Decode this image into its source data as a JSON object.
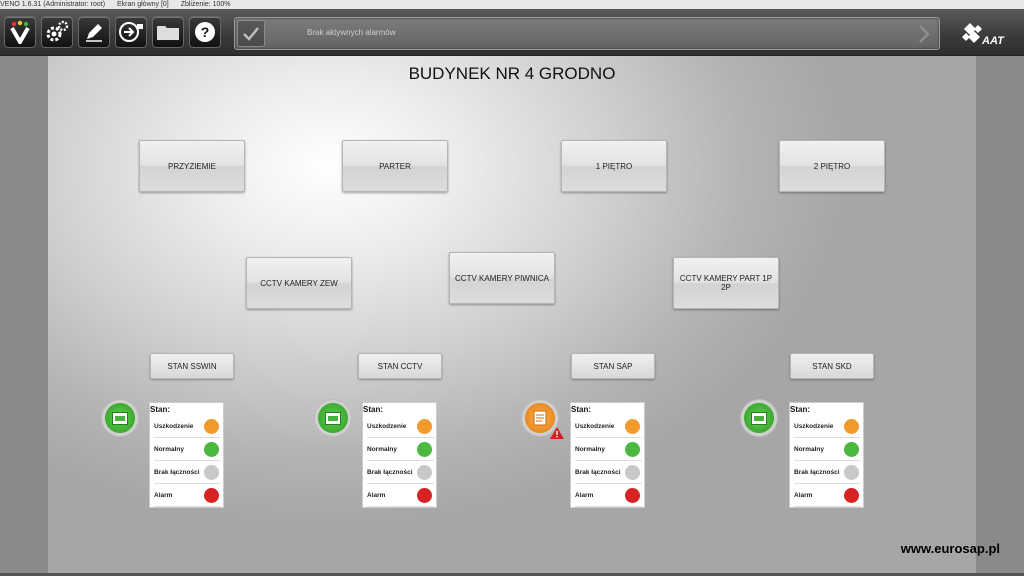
{
  "titlebar": {
    "app": "VENO 1.6.31 (Administrator: root)",
    "screen": "Ekran główny [0]",
    "zoom": "Zbliżenie: 100%"
  },
  "toolbar": {
    "buttons": [
      {
        "icon": "veno-logo-icon"
      },
      {
        "icon": "settings-gears-icon"
      },
      {
        "icon": "edit-pencil-icon"
      },
      {
        "icon": "exit-screen-icon"
      },
      {
        "icon": "folder-icon"
      },
      {
        "icon": "help-icon"
      }
    ],
    "alarm_text": "Brak aktywnych alarmów"
  },
  "panel": {
    "title": "BUDYNEK NR 4 GRODNO",
    "floors": [
      "PRZYZIEMIE",
      "PARTER",
      "1 PIĘTRO",
      "2 PIĘTRO"
    ],
    "cameras": [
      "CCTV KAMERY ZEW",
      "CCTV KAMERY PIWNICA",
      "CCTV KAMERY PART 1P 2P"
    ],
    "stan_buttons": [
      "STAN SSWIN",
      "STAN CCTV",
      "STAN SAP",
      "STAN SKD"
    ],
    "status_states": [
      "normal",
      "normal",
      "fault-warning",
      "normal"
    ],
    "legend": {
      "title": "Stan:",
      "rows": [
        "Uszkodzenie",
        "Normalny",
        "Brak łączności",
        "Alarm"
      ]
    }
  },
  "colors": {
    "fault": "#f39a2d",
    "normal": "#4cb83e",
    "no_connection": "#c8c8c8",
    "alarm": "#d62424"
  },
  "watermark": "www.eurosap.pl"
}
